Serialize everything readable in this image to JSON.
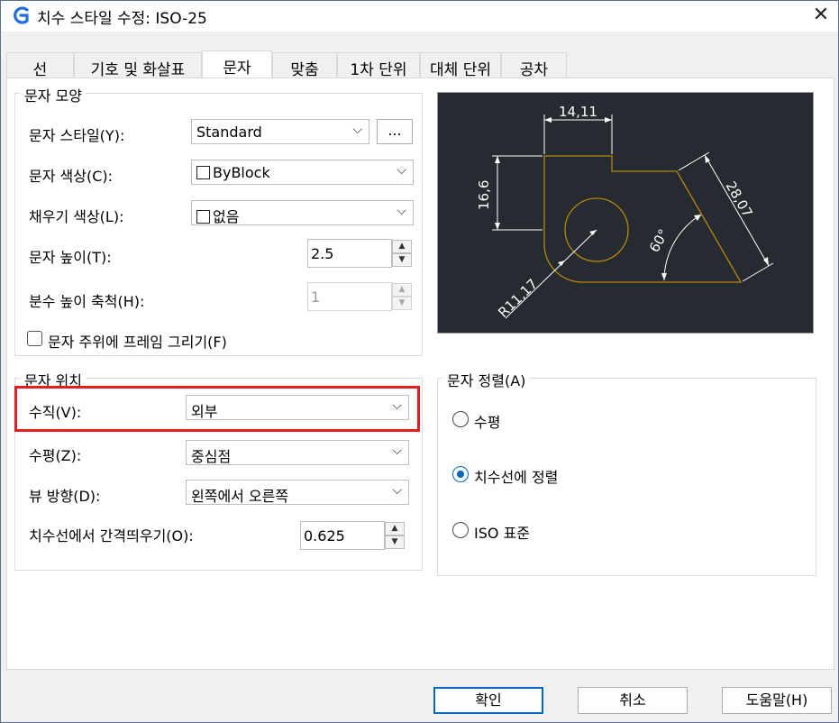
{
  "window": {
    "title": "치수 스타일 수정: ISO-25"
  },
  "tabs": [
    {
      "label": "선"
    },
    {
      "label": "기호 및 화살표"
    },
    {
      "label": "문자"
    },
    {
      "label": "맞춤"
    },
    {
      "label": "1차 단위"
    },
    {
      "label": "대체 단위"
    },
    {
      "label": "공차"
    }
  ],
  "active_tab": "문자",
  "appearance": {
    "title": "문자 모양",
    "style_label": "문자 스타일(Y):",
    "style_value": "Standard",
    "style_browse": "...",
    "color_label": "문자 색상(C):",
    "color_value": "ByBlock",
    "fill_label": "채우기 색상(L):",
    "fill_value": "없음",
    "height_label": "문자 높이(T):",
    "height_value": "2.5",
    "fraction_label": "분수 높이 축척(H):",
    "fraction_value": "1",
    "frame_label": "문자 주위에 프레임 그리기(F)",
    "frame_checked": false
  },
  "placement": {
    "title": "문자 위치",
    "vertical_label": "수직(V):",
    "vertical_value": "외부",
    "horizontal_label": "수평(Z):",
    "horizontal_value": "중심점",
    "view_label": "뷰 방향(D):",
    "view_value": "왼쪽에서 오른쪽",
    "offset_label": "치수선에서 간격띄우기(O):",
    "offset_value": "0.625"
  },
  "alignment": {
    "title": "문자 정렬(A)",
    "options": [
      {
        "label": "수평",
        "selected": false
      },
      {
        "label": "치수선에 정렬",
        "selected": true
      },
      {
        "label": "ISO 표준",
        "selected": false
      }
    ]
  },
  "preview": {
    "dim_top": "14,11",
    "dim_left": "16,6",
    "dim_right": "28,07",
    "dim_angle": "60°",
    "dim_radius": "R11,17",
    "colors": {
      "background": "#252b30",
      "geometry": "#b8860b",
      "dimension": "#ffffff"
    }
  },
  "buttons": {
    "ok": "확인",
    "cancel": "취소",
    "help": "도움말(H)"
  },
  "colors": {
    "accent": "#0067c0",
    "highlight": "#e02020"
  }
}
